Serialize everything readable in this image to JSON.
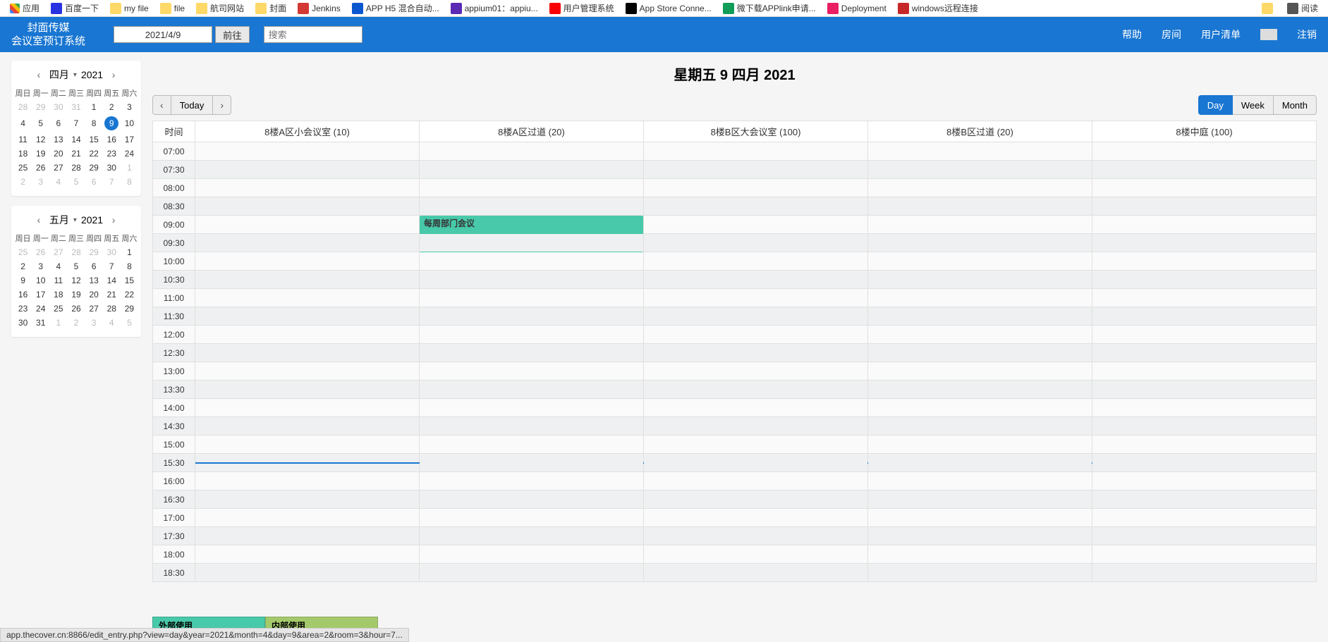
{
  "bookmarks": {
    "apps": "应用",
    "items": [
      {
        "icon": "bk-baidu",
        "label": "百度一下"
      },
      {
        "icon": "bk-folder",
        "label": "my file"
      },
      {
        "icon": "bk-folder",
        "label": "file"
      },
      {
        "icon": "bk-folder",
        "label": "航司网站"
      },
      {
        "icon": "bk-folder",
        "label": "封面"
      },
      {
        "icon": "bk-jenkins",
        "label": "Jenkins"
      },
      {
        "icon": "bk-shield",
        "label": "APP H5 混合自动..."
      },
      {
        "icon": "bk-appium",
        "label": "appium01：appiu..."
      },
      {
        "icon": "bk-oracle",
        "label": "用户管理系统"
      },
      {
        "icon": "bk-apple",
        "label": "App Store Conne..."
      },
      {
        "icon": "bk-sheets",
        "label": "微下载APPlink申请..."
      },
      {
        "icon": "bk-deploy",
        "label": "Deployment"
      },
      {
        "icon": "bk-win",
        "label": "windows远程连接"
      }
    ],
    "right": [
      {
        "icon": "bk-folder",
        "label": ""
      },
      {
        "icon": "bk-read",
        "label": "阅读"
      }
    ]
  },
  "header": {
    "brand_line1": "封面传媒",
    "brand_line2": "会议室预订系统",
    "date_value": "2021/4/9",
    "go_label": "前往",
    "search_placeholder": "搜索",
    "nav": {
      "help": "帮助",
      "rooms": "房间",
      "users": "用户清单",
      "logout": "注销"
    }
  },
  "page_title": "星期五 9 四月 2021",
  "toolbar": {
    "today": "Today",
    "views": {
      "day": "Day",
      "week": "Week",
      "month": "Month"
    }
  },
  "calendars": [
    {
      "month": "四月",
      "year": "2021",
      "weekdays": [
        "周日",
        "周一",
        "周二",
        "周三",
        "周四",
        "周五",
        "周六"
      ],
      "days": [
        [
          {
            "d": 28,
            "o": 1
          },
          {
            "d": 29,
            "o": 1
          },
          {
            "d": 30,
            "o": 1
          },
          {
            "d": 31,
            "o": 1
          },
          {
            "d": 1
          },
          {
            "d": 2
          },
          {
            "d": 3
          }
        ],
        [
          {
            "d": 4
          },
          {
            "d": 5
          },
          {
            "d": 6
          },
          {
            "d": 7
          },
          {
            "d": 8
          },
          {
            "d": 9,
            "sel": 1
          },
          {
            "d": 10
          }
        ],
        [
          {
            "d": 11
          },
          {
            "d": 12
          },
          {
            "d": 13
          },
          {
            "d": 14
          },
          {
            "d": 15
          },
          {
            "d": 16
          },
          {
            "d": 17
          }
        ],
        [
          {
            "d": 18
          },
          {
            "d": 19
          },
          {
            "d": 20
          },
          {
            "d": 21
          },
          {
            "d": 22
          },
          {
            "d": 23
          },
          {
            "d": 24
          }
        ],
        [
          {
            "d": 25
          },
          {
            "d": 26
          },
          {
            "d": 27
          },
          {
            "d": 28
          },
          {
            "d": 29
          },
          {
            "d": 30
          },
          {
            "d": 1,
            "o": 1
          }
        ],
        [
          {
            "d": 2,
            "o": 1
          },
          {
            "d": 3,
            "o": 1
          },
          {
            "d": 4,
            "o": 1
          },
          {
            "d": 5,
            "o": 1
          },
          {
            "d": 6,
            "o": 1
          },
          {
            "d": 7,
            "o": 1
          },
          {
            "d": 8,
            "o": 1
          }
        ]
      ]
    },
    {
      "month": "五月",
      "year": "2021",
      "weekdays": [
        "周日",
        "周一",
        "周二",
        "周三",
        "周四",
        "周五",
        "周六"
      ],
      "days": [
        [
          {
            "d": 25,
            "o": 1
          },
          {
            "d": 26,
            "o": 1
          },
          {
            "d": 27,
            "o": 1
          },
          {
            "d": 28,
            "o": 1
          },
          {
            "d": 29,
            "o": 1
          },
          {
            "d": 30,
            "o": 1
          },
          {
            "d": 1
          }
        ],
        [
          {
            "d": 2
          },
          {
            "d": 3
          },
          {
            "d": 4
          },
          {
            "d": 5
          },
          {
            "d": 6
          },
          {
            "d": 7
          },
          {
            "d": 8
          }
        ],
        [
          {
            "d": 9
          },
          {
            "d": 10
          },
          {
            "d": 11
          },
          {
            "d": 12
          },
          {
            "d": 13
          },
          {
            "d": 14
          },
          {
            "d": 15
          }
        ],
        [
          {
            "d": 16
          },
          {
            "d": 17
          },
          {
            "d": 18
          },
          {
            "d": 19
          },
          {
            "d": 20
          },
          {
            "d": 21
          },
          {
            "d": 22
          }
        ],
        [
          {
            "d": 23
          },
          {
            "d": 24
          },
          {
            "d": 25
          },
          {
            "d": 26
          },
          {
            "d": 27
          },
          {
            "d": 28
          },
          {
            "d": 29
          }
        ],
        [
          {
            "d": 30
          },
          {
            "d": 31
          },
          {
            "d": 1,
            "o": 1
          },
          {
            "d": 2,
            "o": 1
          },
          {
            "d": 3,
            "o": 1
          },
          {
            "d": 4,
            "o": 1
          },
          {
            "d": 5,
            "o": 1
          }
        ]
      ]
    }
  ],
  "grid": {
    "time_header": "时间",
    "rooms": [
      "8楼A区小会议室 (10)",
      "8楼A区过道 (20)",
      "8楼B区大会议室 (100)",
      "8楼B区过道 (20)",
      "8楼中庭 (100)"
    ],
    "times": [
      "07:00",
      "07:30",
      "08:00",
      "08:30",
      "09:00",
      "09:30",
      "10:00",
      "10:30",
      "11:00",
      "11:30",
      "12:00",
      "12:30",
      "13:00",
      "13:30",
      "14:00",
      "14:30",
      "15:00",
      "15:30",
      "16:00",
      "16:30",
      "17:00",
      "17:30",
      "18:00",
      "18:30"
    ],
    "events": [
      {
        "room": 1,
        "start": "09:00",
        "span": 2,
        "title": "每周部门会议"
      }
    ],
    "now_after": "15:30"
  },
  "legend": {
    "external": "外部使用",
    "internal": "内部使用"
  },
  "status_url": "app.thecover.cn:8866/edit_entry.php?view=day&year=2021&month=4&day=9&area=2&room=3&hour=7..."
}
